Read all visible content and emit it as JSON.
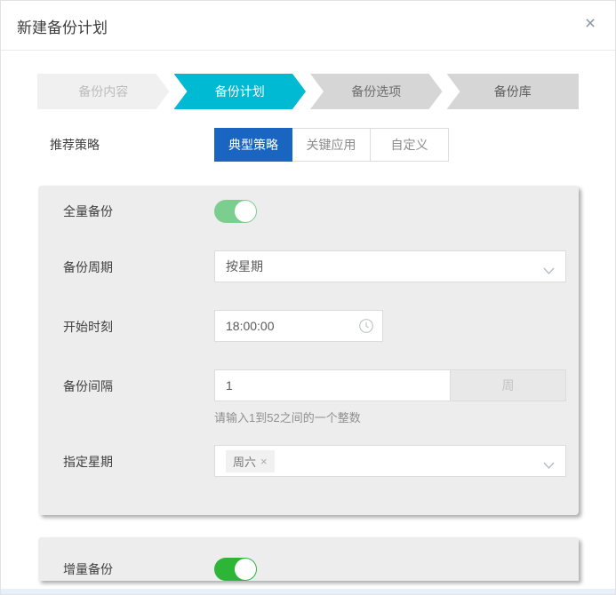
{
  "header": {
    "title": "新建备份计划",
    "close_icon": "×"
  },
  "steps": {
    "active": "备份计划",
    "items": [
      {
        "label": "备份内容",
        "state": "done"
      },
      {
        "label": "备份计划",
        "state": "active"
      },
      {
        "label": "备份选项",
        "state": "upcoming"
      },
      {
        "label": "备份库",
        "state": "upcoming"
      }
    ]
  },
  "strategy": {
    "label": "推荐策略",
    "selected": "典型策略",
    "options": [
      {
        "label": "典型策略"
      },
      {
        "label": "关键应用"
      },
      {
        "label": "自定义"
      }
    ]
  },
  "full_backup": {
    "label": "全量备份",
    "toggle": "on",
    "cycle": {
      "label": "备份周期",
      "value": "按星期"
    },
    "start_time": {
      "label": "开始时刻",
      "value": "18:00:00"
    },
    "interval": {
      "label": "备份间隔",
      "value": "1",
      "unit": "周",
      "hint": "请输入1到52之间的一个整数"
    },
    "weekday": {
      "label": "指定星期",
      "tags": [
        {
          "label": "周六",
          "close": "×"
        }
      ]
    }
  },
  "incremental_backup": {
    "label": "增量备份",
    "toggle": "on"
  },
  "colors": {
    "step_active_cyan": "#00b9d3",
    "button_primary_blue": "#1b65c2",
    "toggle_green_soft": "#7bce8e",
    "toggle_green_bright": "#2cb537"
  }
}
